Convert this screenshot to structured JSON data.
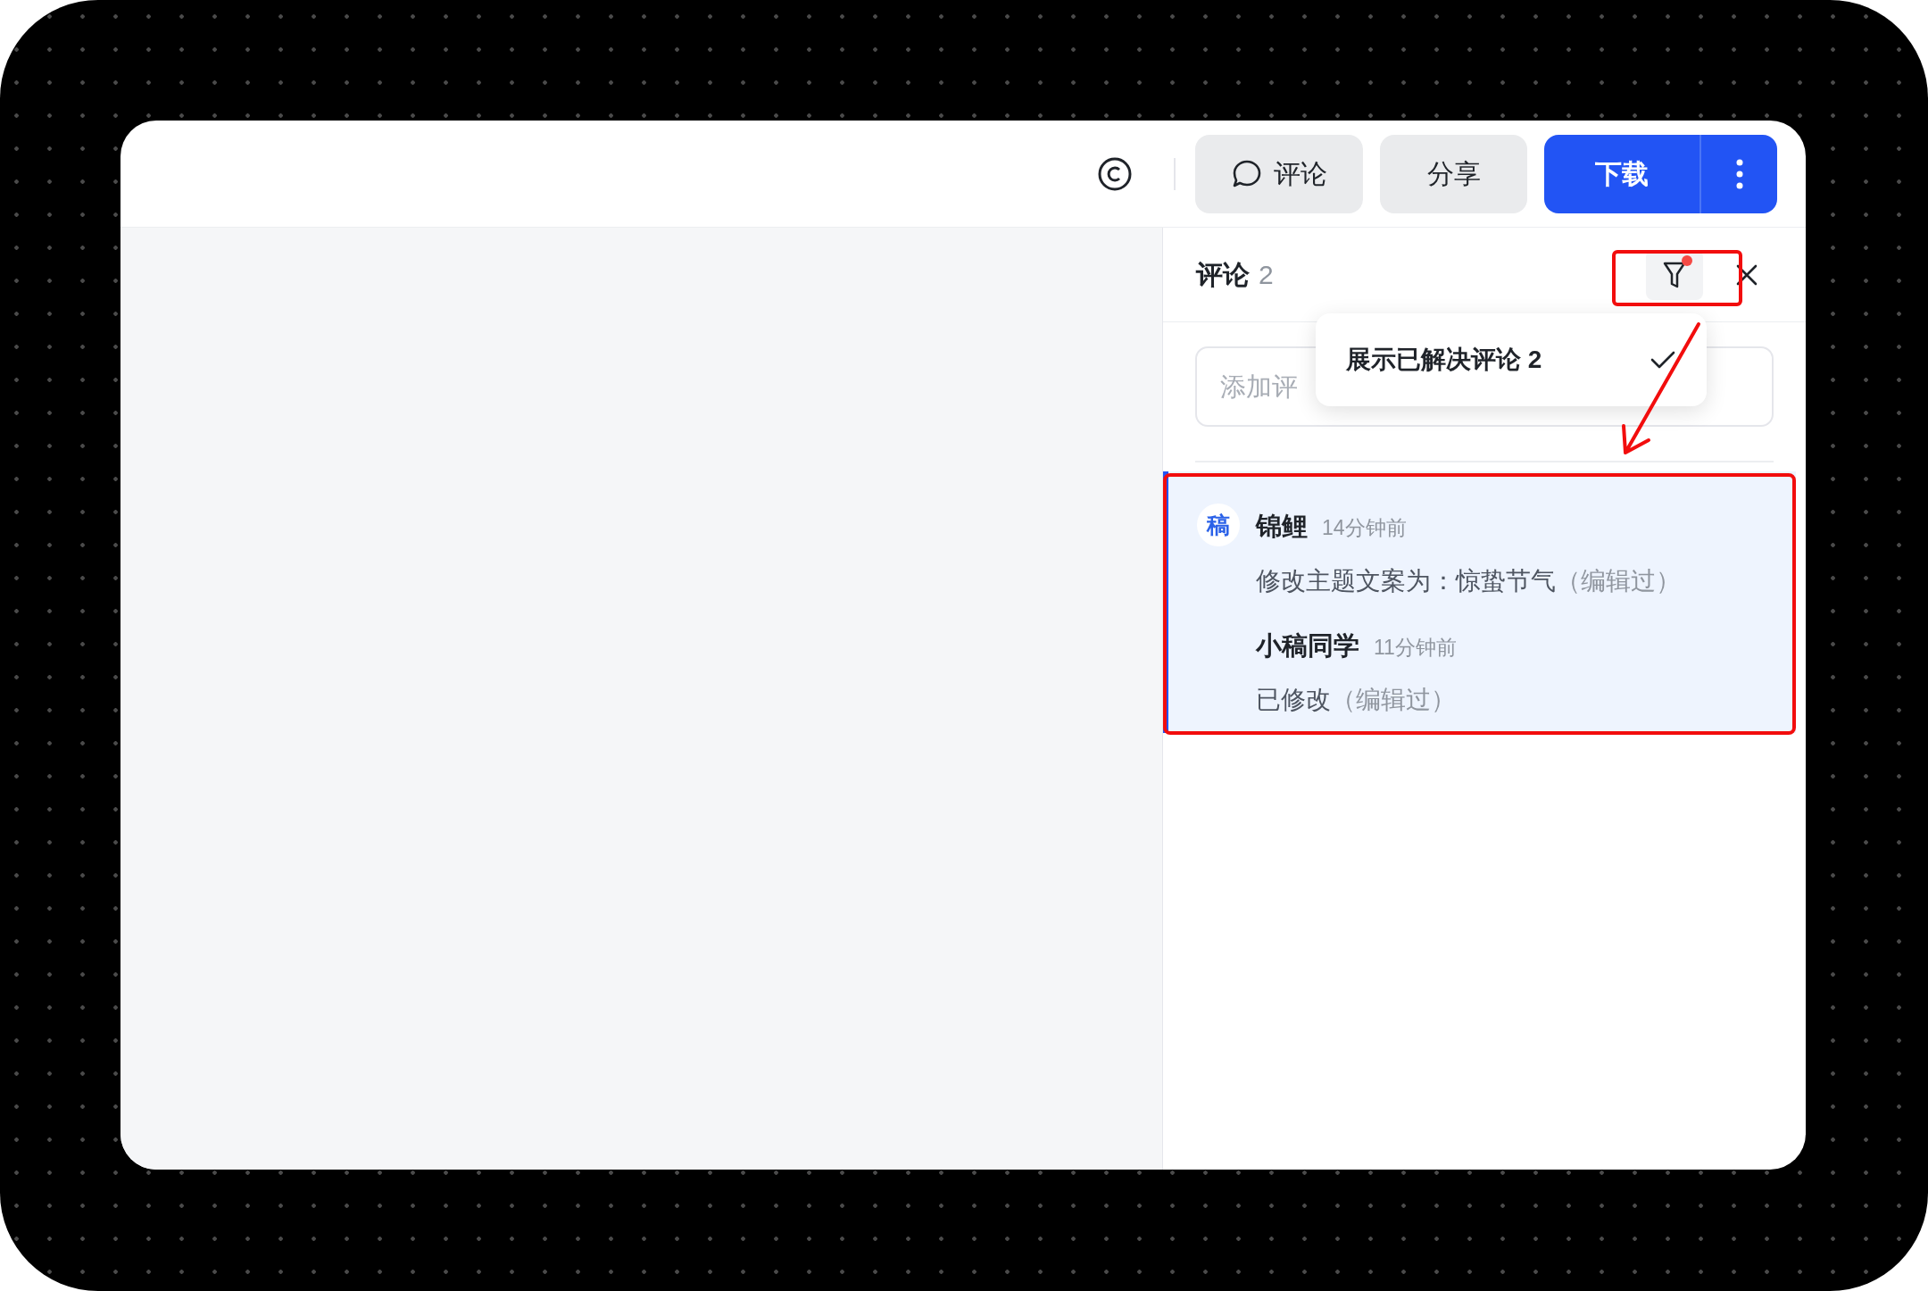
{
  "toolbar": {
    "comment_button": "评论",
    "share_button": "分享",
    "download_button": "下载"
  },
  "panel": {
    "title": "评论",
    "count": "2",
    "filter_active": true,
    "filter_menu": {
      "items": [
        {
          "label": "展示已解决评论 2",
          "checked": true
        }
      ]
    },
    "input": {
      "placeholder": "添加评"
    },
    "threads": [
      {
        "selected": true,
        "comments": [
          {
            "avatar": "稿",
            "author": "锦鲤",
            "time": "14分钟前",
            "text": "修改主题文案为：惊蛰节气",
            "edited": "（编辑过）"
          },
          {
            "author": "小稿同学",
            "time": "11分钟前",
            "text": "已修改",
            "edited": "（编辑过）"
          }
        ]
      }
    ]
  }
}
